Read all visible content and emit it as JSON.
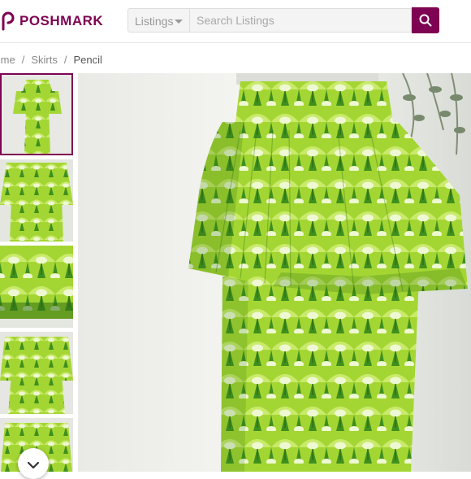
{
  "brand": {
    "name": "POSHMARK",
    "color": "#7f0353",
    "icon": "poshmark-logo-icon"
  },
  "search": {
    "scope_label": "Listings",
    "placeholder": "Search Listings",
    "button_icon": "search-icon"
  },
  "breadcrumb": {
    "items": [
      "Home",
      "Skirts",
      "Pencil"
    ]
  },
  "gallery": {
    "thumbnail_count": 5,
    "selected_index": 0,
    "scroll_icon": "chevron-down-icon"
  },
  "colors": {
    "accent": "#7f0353",
    "fabric_lime": "#a4d633",
    "fabric_green": "#3f8f1f",
    "fabric_pale": "#e9f5c8"
  }
}
